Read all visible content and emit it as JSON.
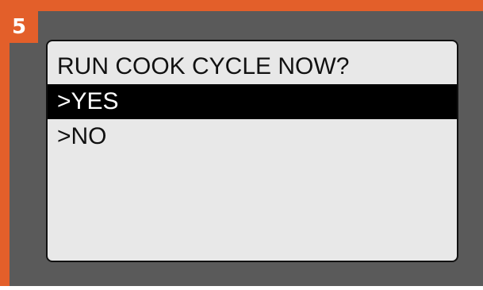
{
  "step": {
    "number": "5"
  },
  "display": {
    "prompt": "RUN COOK CYCLE NOW?",
    "options": [
      {
        "label": ">YES",
        "selected": true
      },
      {
        "label": ">NO",
        "selected": false
      }
    ]
  },
  "colors": {
    "accent": "#e35f2a",
    "bezel": "#5a5a5a",
    "screen": "#e8e8e8",
    "highlight": "#000000"
  }
}
